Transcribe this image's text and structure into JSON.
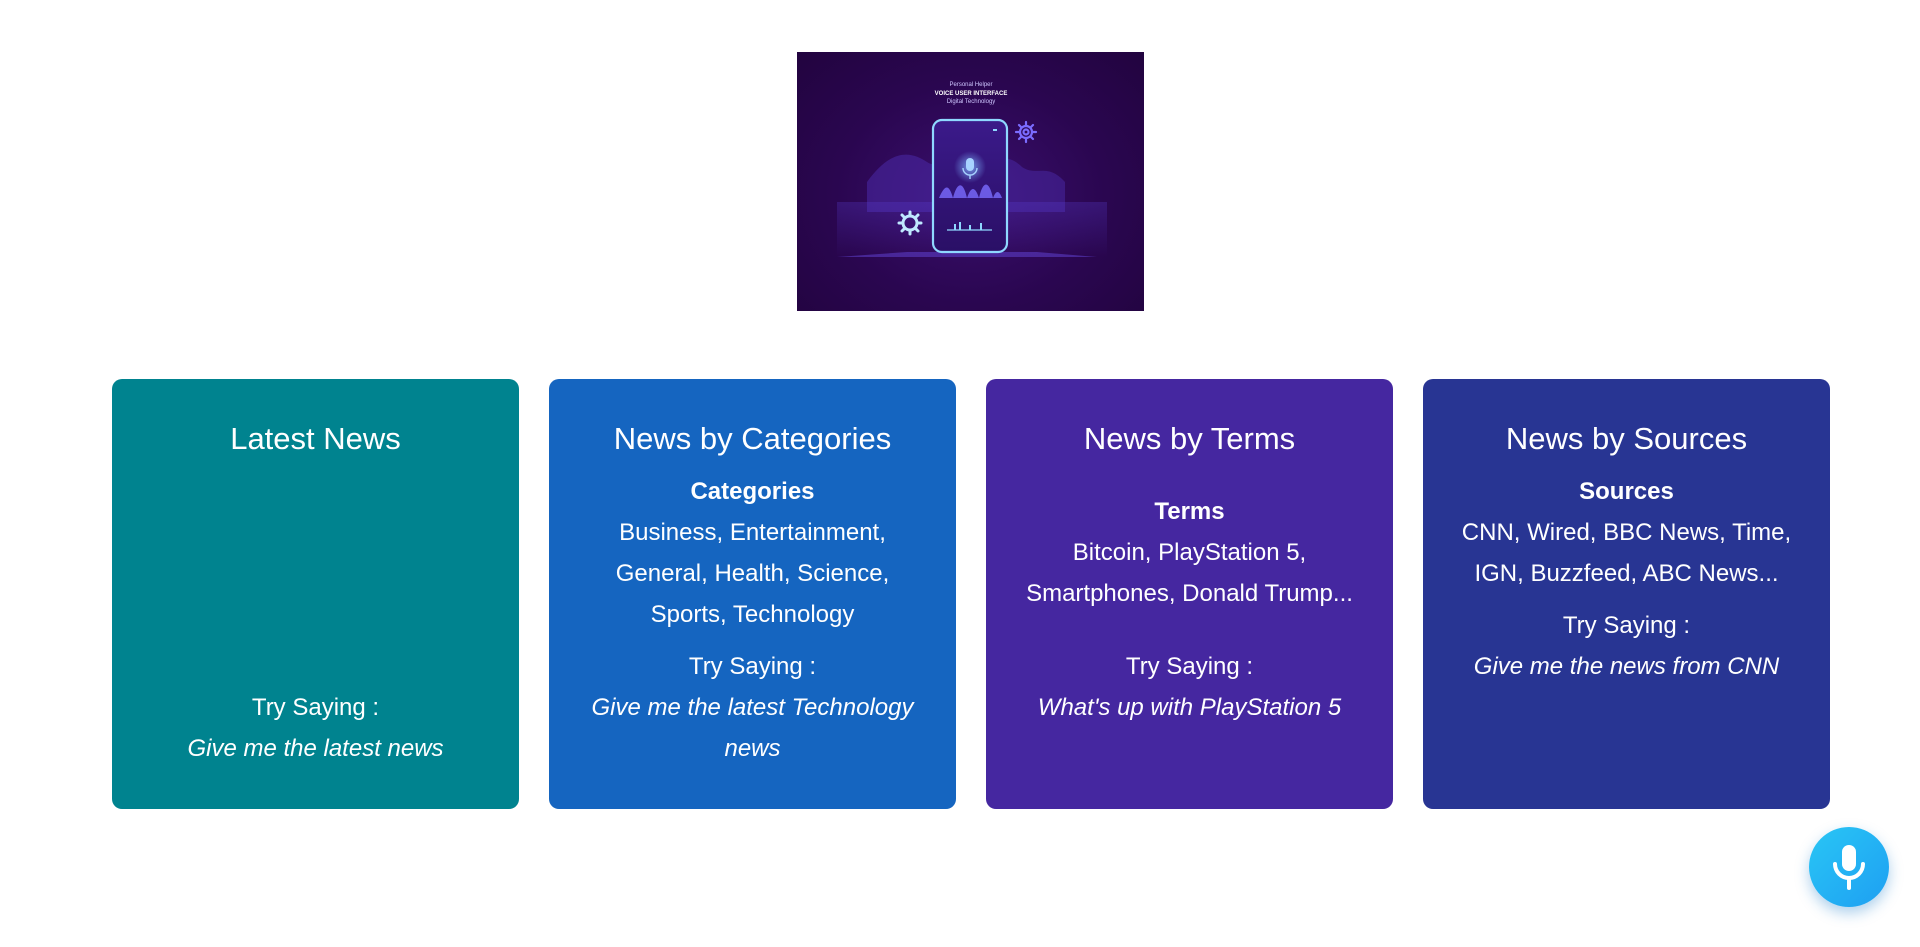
{
  "hero": {
    "caption_line1": "Personal Helper",
    "caption_line2": "VOICE USER INTERFACE",
    "caption_line3": "Digital Technology"
  },
  "cards": [
    {
      "title": "Latest News",
      "try_label": "Try Saying :",
      "try_example": "Give me the latest news"
    },
    {
      "title": "News by Categories",
      "subhead": "Categories",
      "list": "Business, Entertainment, General, Health, Science, Sports, Technology",
      "try_label": "Try Saying :",
      "try_example": "Give me the latest Technology news"
    },
    {
      "title": "News by Terms",
      "subhead": "Terms",
      "list": "Bitcoin, PlayStation 5, Smartphones, Donald Trump...",
      "try_label": "Try Saying :",
      "try_example": "What's up with PlayStation 5"
    },
    {
      "title": "News by Sources",
      "subhead": "Sources",
      "list": "CNN, Wired, BBC News, Time, IGN, Buzzfeed, ABC News...",
      "try_label": "Try Saying :",
      "try_example": "Give me the news from CNN"
    }
  ],
  "colors": {
    "latest": "#00838f",
    "categories": "#1565c0",
    "terms": "#4527a0",
    "sources": "#283593",
    "mic_button": "#1e9ff2"
  },
  "mic_button": {
    "icon": "microphone-icon"
  }
}
